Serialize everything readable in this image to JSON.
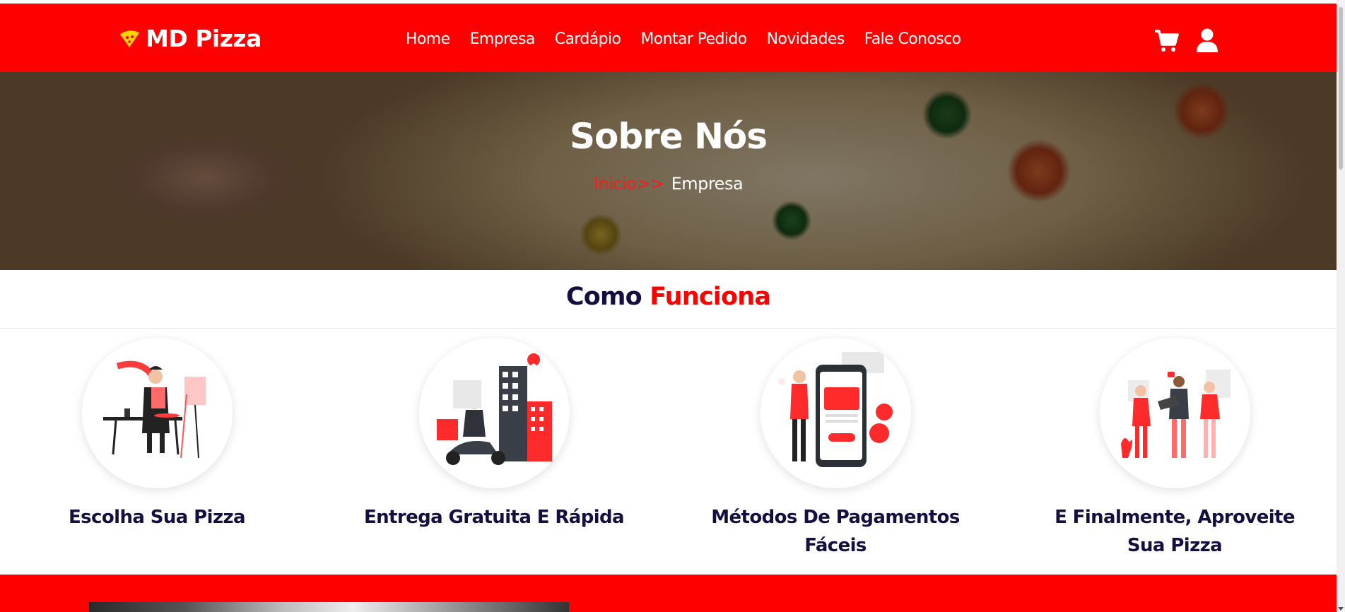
{
  "header": {
    "brand": "MD Pizza",
    "nav": [
      "Home",
      "Empresa",
      "Cardápio",
      "Montar Pedido",
      "Novidades",
      "Fale Conosco"
    ],
    "icons": [
      "cart-icon",
      "user-icon"
    ]
  },
  "hero": {
    "title": "Sobre Nós",
    "breadcrumb": {
      "link": "Inicio",
      "separator": ">>",
      "current": "Empresa"
    }
  },
  "section": {
    "title_part1": "Como",
    "title_part2": "Funciona",
    "steps": [
      {
        "label": "Escolha Sua Pizza"
      },
      {
        "label": "Entrega Gratuita E Rápida"
      },
      {
        "label": "Métodos De Pagamentos Fáceis"
      },
      {
        "label": "E Finalmente, Aproveite Sua Pizza"
      }
    ]
  },
  "colors": {
    "brand_red": "#ff0000",
    "heading_navy": "#130f40",
    "white": "#ffffff"
  }
}
